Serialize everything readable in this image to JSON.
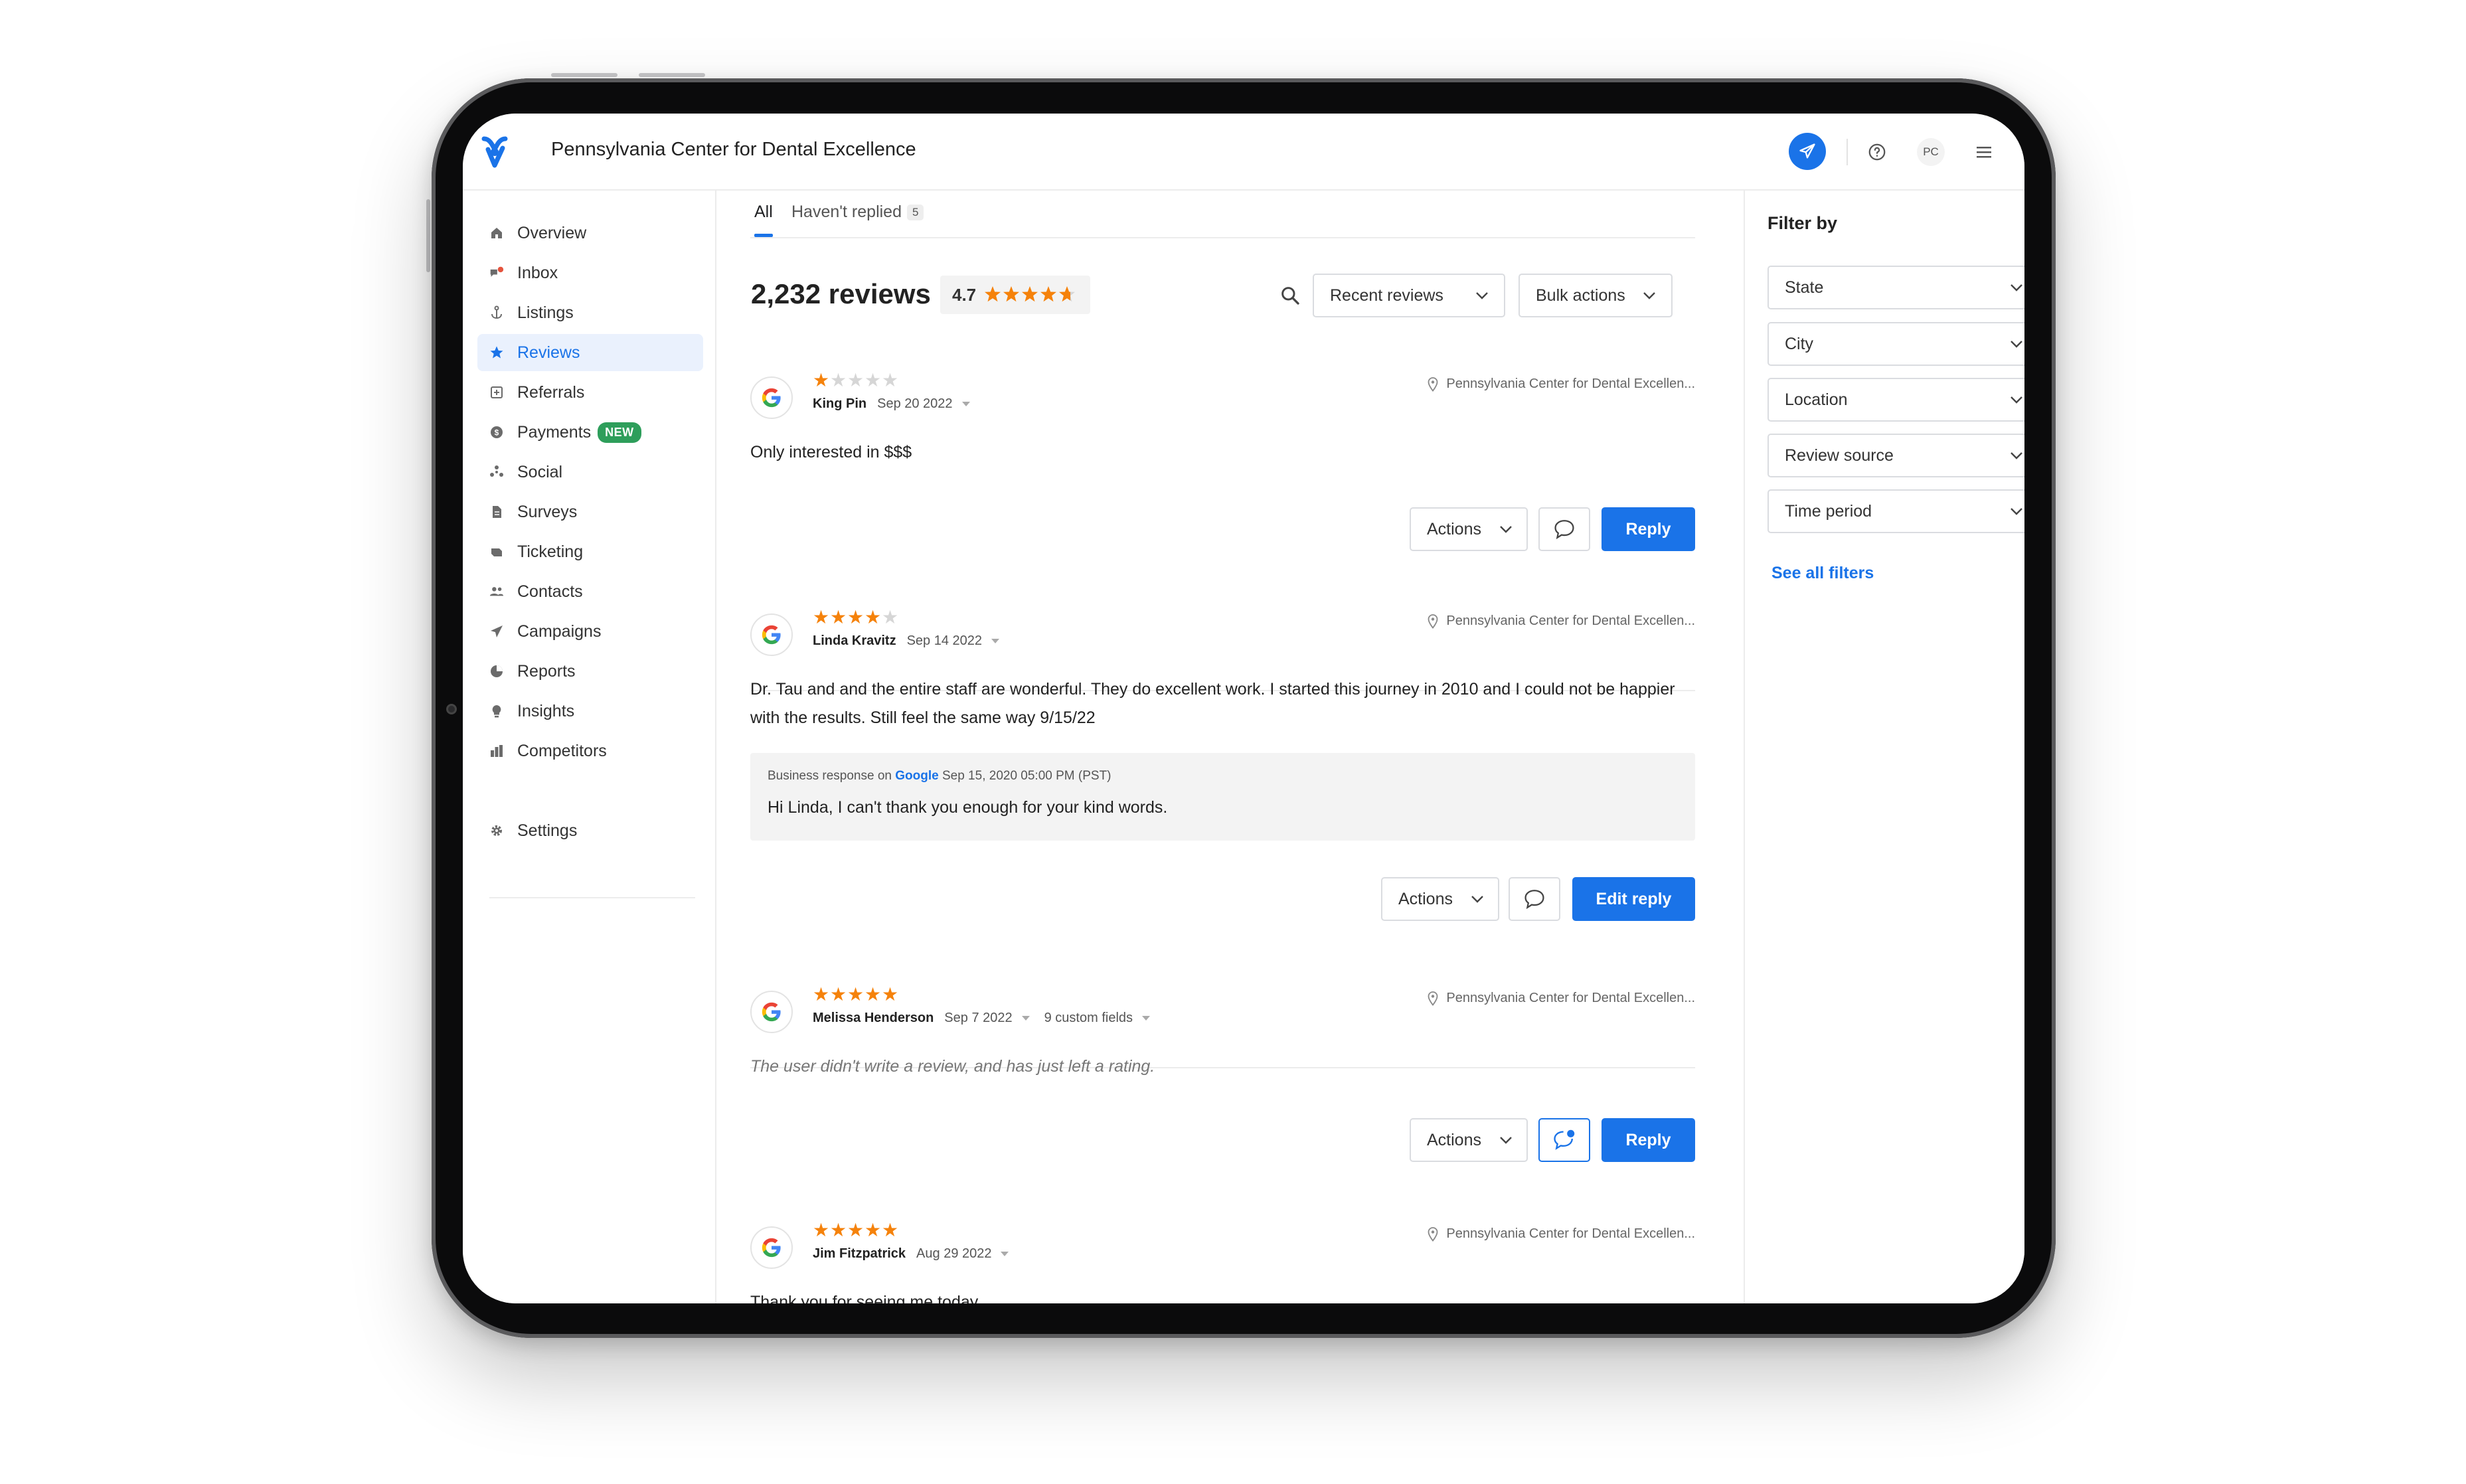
{
  "header": {
    "business_name": "Pennsylvania Center for Dental Excellence",
    "avatar_initials": "PC",
    "brand_color": "#1a73e8"
  },
  "sidebar": {
    "items": [
      {
        "label": "Overview",
        "icon": "home-icon"
      },
      {
        "label": "Inbox",
        "icon": "chat-bubbles-icon"
      },
      {
        "label": "Listings",
        "icon": "anchor-icon"
      },
      {
        "label": "Reviews",
        "icon": "star-icon",
        "active": true
      },
      {
        "label": "Referrals",
        "icon": "referral-icon"
      },
      {
        "label": "Payments",
        "icon": "dollar-icon",
        "badge": "NEW"
      },
      {
        "label": "Social",
        "icon": "social-network-icon"
      },
      {
        "label": "Surveys",
        "icon": "document-icon"
      },
      {
        "label": "Ticketing",
        "icon": "ticket-icon"
      },
      {
        "label": "Contacts",
        "icon": "people-icon"
      },
      {
        "label": "Campaigns",
        "icon": "paper-plane-icon"
      },
      {
        "label": "Reports",
        "icon": "pie-chart-icon"
      },
      {
        "label": "Insights",
        "icon": "lightbulb-icon"
      },
      {
        "label": "Competitors",
        "icon": "bar-chart-icon"
      }
    ],
    "settings_label": "Settings"
  },
  "tabs": [
    {
      "label": "All",
      "active": true
    },
    {
      "label": "Haven't replied",
      "count": "5"
    }
  ],
  "summary": {
    "review_count": "2,232 reviews",
    "avg_rating": "4.7",
    "avg_stars": 4.7
  },
  "toolbar": {
    "sort_label": "Recent reviews",
    "bulk_label": "Bulk actions"
  },
  "reviews": [
    {
      "rating": 1,
      "name": "King Pin",
      "date": "Sep 20 2022",
      "location": "Pennsylvania Center for Dental Excellen...",
      "text": "Only interested in $$$",
      "actions_label": "Actions",
      "reply_label": "Reply"
    },
    {
      "rating": 4,
      "name": "Linda Kravitz",
      "date": "Sep 14 2022",
      "location": "Pennsylvania Center for Dental Excellen...",
      "text": "Dr. Tau and and the entire staff are wonderful. They do excellent work. I started this journey in 2010 and I could not be happier with the results. Still feel the same way 9/15/22",
      "response": {
        "prefix": "Business response on",
        "source": "Google",
        "timestamp": "Sep 15, 2020 05:00 PM (PST)",
        "text": "Hi Linda, I can't thank you enough for your kind words."
      },
      "actions_label": "Actions",
      "reply_label": "Edit reply"
    },
    {
      "rating": 5,
      "name": "Melissa Henderson",
      "date": "Sep 7 2022",
      "custom_fields": "9 custom fields",
      "location": "Pennsylvania Center for Dental Excellen...",
      "text": "The user didn't write a review, and has just left a rating.",
      "actions_label": "Actions",
      "reply_label": "Reply"
    },
    {
      "rating": 5,
      "name": "Jim Fitzpatrick",
      "date": "Aug 29 2022",
      "location": "Pennsylvania Center for Dental Excellen...",
      "text": "Thank you for seeing me today."
    }
  ],
  "filters": {
    "title": "Filter by",
    "dropdowns": [
      "State",
      "City",
      "Location",
      "Review source",
      "Time period"
    ],
    "see_all": "See all filters"
  },
  "colors": {
    "star": "#f5820b",
    "star_empty": "#d6d6d6",
    "new_badge": "#2e9e5b"
  }
}
